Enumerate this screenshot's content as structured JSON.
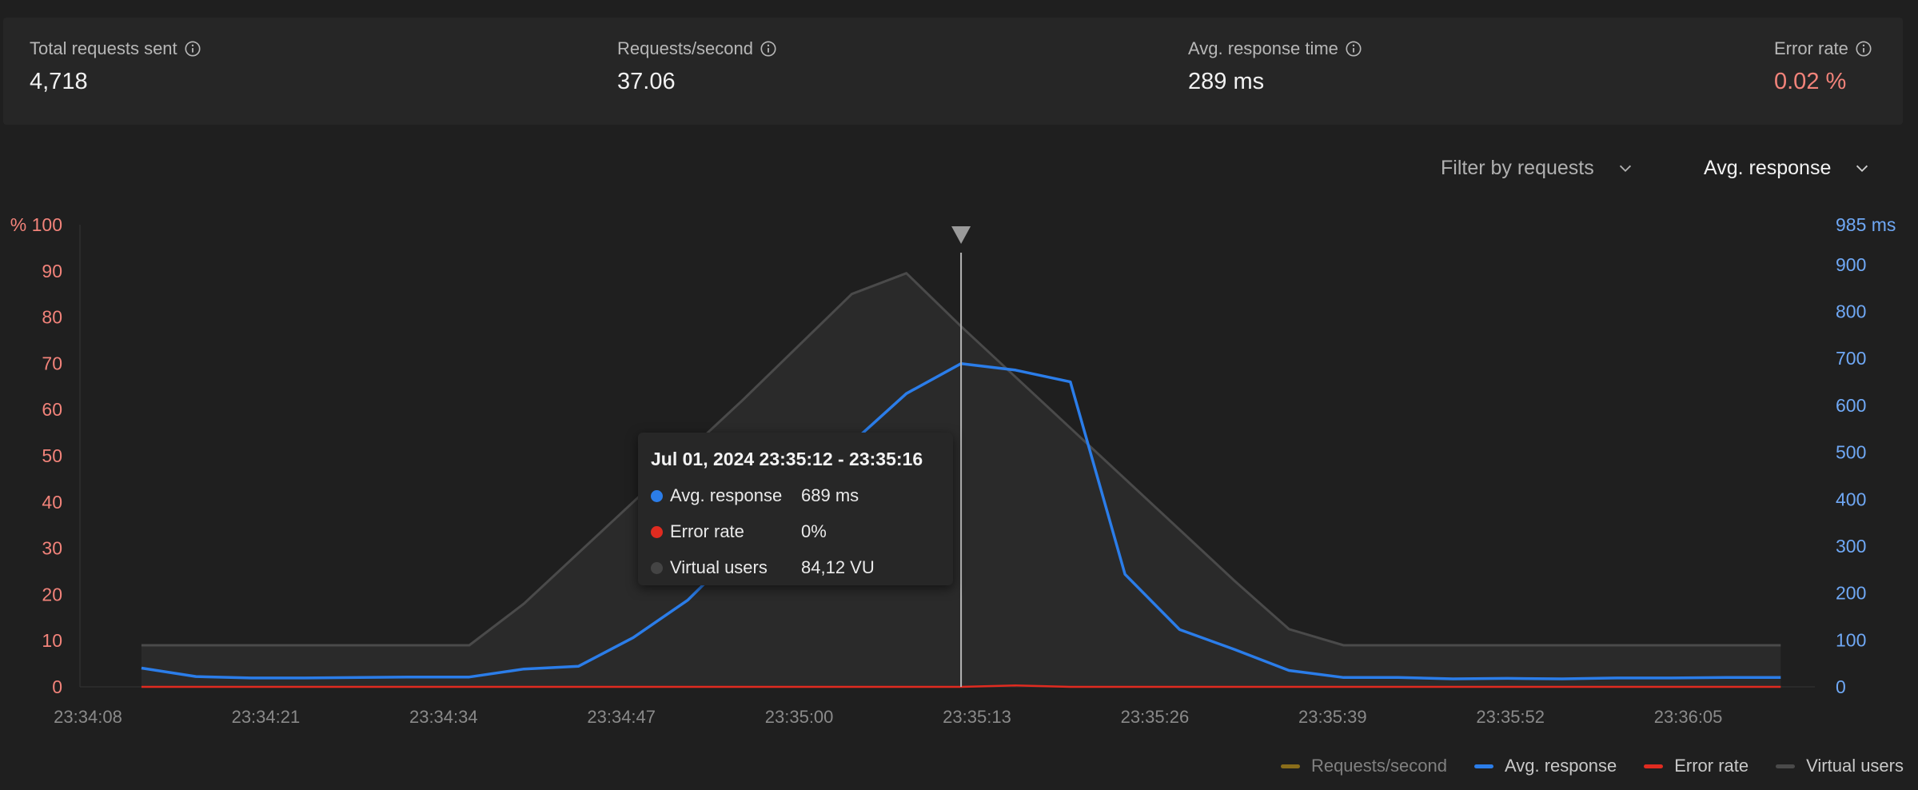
{
  "stats": [
    {
      "label": "Total requests sent",
      "value": "4,718"
    },
    {
      "label": "Requests/second",
      "value": "37.06"
    },
    {
      "label": "Avg. response time",
      "value": "289 ms"
    },
    {
      "label": "Error rate",
      "value": "0.02 %"
    }
  ],
  "filters": {
    "requests": "Filter by requests",
    "metric": "Avg. response"
  },
  "tooltip": {
    "title": "Jul 01, 2024 23:35:12 - 23:35:16",
    "rows": [
      {
        "name": "Avg. response",
        "value": "689 ms",
        "color": "#2b7de9"
      },
      {
        "name": "Error rate",
        "value": "0%",
        "color": "#e02b20"
      },
      {
        "name": "Virtual users",
        "value": "84,12 VU",
        "color": "#444444"
      }
    ]
  },
  "legend": [
    {
      "label": "Requests/second",
      "color": "#8a6d1a",
      "muted": true
    },
    {
      "label": "Avg. response",
      "color": "#2b7de9",
      "muted": false
    },
    {
      "label": "Error rate",
      "color": "#e02b20",
      "muted": false
    },
    {
      "label": "Virtual users",
      "color": "#4a4a4a",
      "muted": false
    }
  ],
  "colors": {
    "left_axis": "#f2837a",
    "right_axis": "#6fa8f5",
    "avg_response": "#2b7de9",
    "error_rate": "#e02b20",
    "virtual_users": "#4a4a4a"
  },
  "chart_data": {
    "type": "line",
    "x_ticks": [
      "23:34:08",
      "23:34:21",
      "23:34:34",
      "23:34:47",
      "23:35:00",
      "23:35:13",
      "23:35:26",
      "23:35:39",
      "23:35:52",
      "23:36:05"
    ],
    "x_range": [
      0,
      127
    ],
    "left_axis": {
      "ticks": [
        "0",
        "10",
        "20",
        "30",
        "40",
        "50",
        "60",
        "70",
        "80",
        "90",
        "% 100"
      ],
      "range": [
        0,
        100
      ]
    },
    "right_axis": {
      "ticks": [
        "0",
        "100",
        "200",
        "300",
        "400",
        "500",
        "600",
        "700",
        "800",
        "900",
        "985 ms"
      ],
      "range": [
        0,
        985
      ]
    },
    "marker_t": 64.5,
    "series": [
      {
        "name": "Virtual users",
        "axis": "left",
        "t": [
          4.5,
          28.5,
          32.5,
          36.5,
          48.5,
          56.5,
          60.5,
          64.5,
          68.5,
          72.5,
          76.5,
          80.5,
          84.5,
          88.5,
          92.5,
          96.5,
          124.5
        ],
        "values": [
          9,
          9,
          18,
          29,
          62,
          85,
          89.5,
          78,
          67,
          56,
          45,
          34,
          23,
          12.5,
          9,
          9,
          9
        ]
      },
      {
        "name": "Avg. response",
        "axis": "right",
        "t": [
          4.5,
          8.5,
          12.5,
          16.5,
          20.5,
          24.5,
          28.5,
          32.5,
          36.5,
          40.5,
          44.5,
          48.5,
          52.5,
          56.5,
          60.5,
          64.5,
          68.5,
          72.5,
          76.5,
          80.5,
          84.5,
          88.5,
          92.5,
          96.5,
          100.5,
          104.5,
          108.5,
          112.5,
          116.5,
          120.5,
          124.5
        ],
        "values": [
          40,
          22,
          19,
          19,
          20,
          21,
          21,
          38,
          44,
          105,
          185,
          300,
          410,
          520,
          625,
          689,
          675,
          650,
          240,
          122,
          80,
          35,
          20,
          20,
          17,
          18,
          17,
          19,
          19,
          20,
          20
        ]
      },
      {
        "name": "Error rate",
        "axis": "left",
        "t": [
          4.5,
          60.5,
          64.5,
          68.5,
          72.5,
          124.5
        ],
        "values": [
          0,
          0,
          0,
          0.3,
          0,
          0
        ]
      }
    ]
  }
}
